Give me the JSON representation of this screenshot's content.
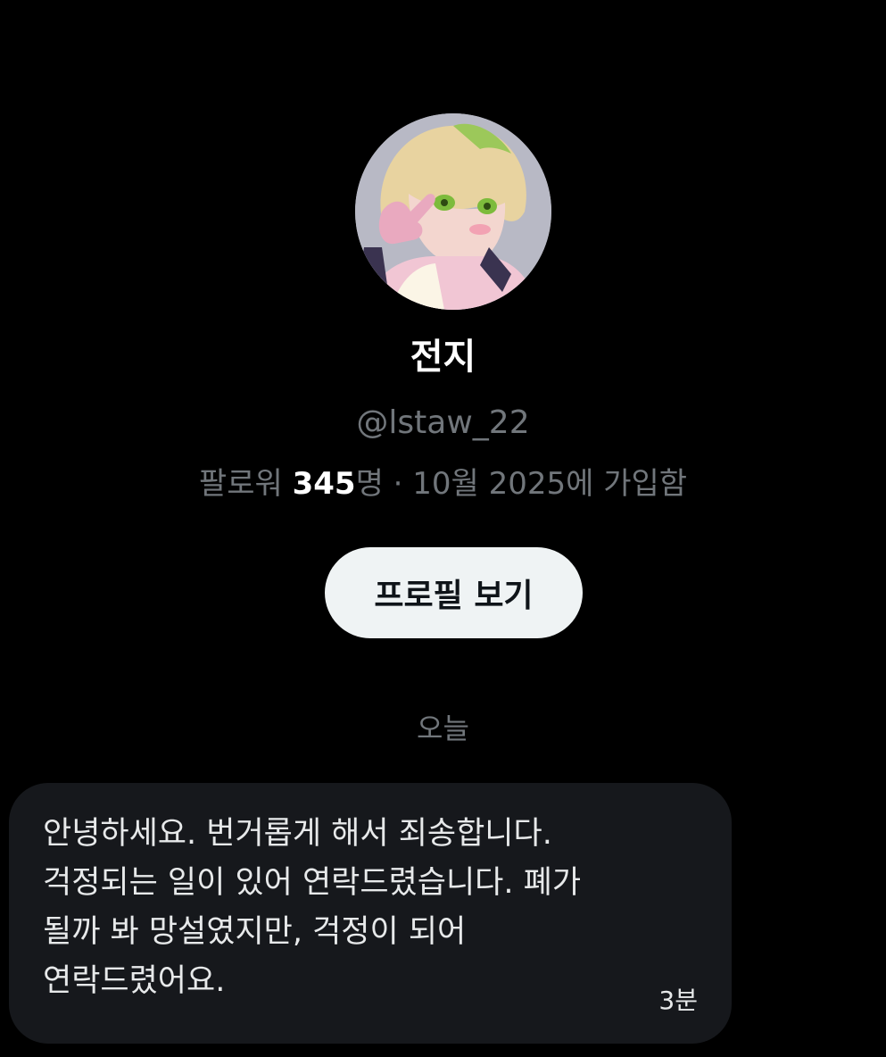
{
  "profile": {
    "display_name": "전지",
    "handle": "@lstaw_22",
    "followers_prefix": "팔로워 ",
    "followers_count": "345",
    "followers_suffix": "명 · 10월 2025에 가입함",
    "view_profile_label": "프로필 보기"
  },
  "conversation": {
    "date_separator": "오늘",
    "messages": [
      {
        "lines": [
          "안녕하세요. 번거롭게 해서 죄송합니다.",
          "걱정되는 일이 있어 연락드렸습니다. 폐가",
          "될까 봐 망설였지만, 걱정이 되어",
          "연락드렸어요."
        ],
        "time": "3분"
      }
    ]
  },
  "colors": {
    "background": "#000000",
    "bubble": "#16181c",
    "secondary_text": "#71767b",
    "button_bg": "#eff3f4"
  }
}
